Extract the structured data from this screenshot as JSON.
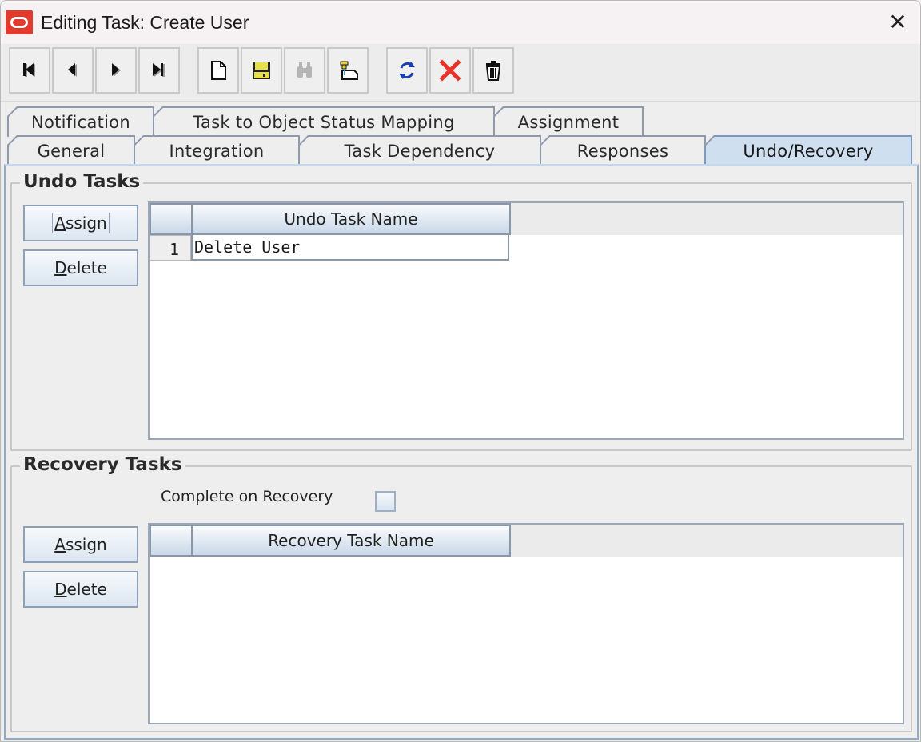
{
  "window": {
    "title": "Editing Task: Create User",
    "close_icon": "close-icon"
  },
  "toolbar": {
    "buttons": [
      {
        "name": "first-record",
        "icon": "skip-to-first-icon",
        "enabled": true
      },
      {
        "name": "previous-record",
        "icon": "previous-arrow-icon",
        "enabled": true
      },
      {
        "name": "next-record",
        "icon": "next-arrow-icon",
        "enabled": true
      },
      {
        "name": "last-record",
        "icon": "skip-to-last-icon",
        "enabled": true
      },
      {
        "name": "new",
        "icon": "new-document-icon",
        "enabled": true
      },
      {
        "name": "save",
        "icon": "floppy-disk-icon",
        "enabled": true
      },
      {
        "name": "find",
        "icon": "binoculars-icon",
        "enabled": false
      },
      {
        "name": "assign",
        "icon": "pushpin-note-icon",
        "enabled": true
      },
      {
        "name": "refresh",
        "icon": "refresh-arrows-icon",
        "enabled": true
      },
      {
        "name": "cancel",
        "icon": "red-x-icon",
        "enabled": true
      },
      {
        "name": "delete",
        "icon": "trash-can-icon",
        "enabled": true
      }
    ]
  },
  "tabs": {
    "row_back": [
      "Notification",
      "Task to Object Status Mapping",
      "Assignment"
    ],
    "row_front": [
      "General",
      "Integration",
      "Task Dependency",
      "Responses",
      "Undo/Recovery"
    ],
    "active": "Undo/Recovery"
  },
  "undo_tasks": {
    "title": "Undo Tasks",
    "assign_label": "Assign",
    "assign_mnemonic": "A",
    "assign_rest": "ssign",
    "delete_label": "Delete",
    "delete_mnemonic": "D",
    "delete_rest": "elete",
    "table": {
      "columns": [
        "",
        "Undo Task Name"
      ],
      "rows": [
        {
          "num": "1",
          "name": "Delete User"
        }
      ]
    }
  },
  "recovery_tasks": {
    "title": "Recovery Tasks",
    "complete_on_recovery_label": "Complete on Recovery",
    "complete_on_recovery_checked": false,
    "assign_label": "Assign",
    "assign_mnemonic": "A",
    "assign_rest": "ssign",
    "delete_label": "Delete",
    "delete_mnemonic": "D",
    "delete_rest": "elete",
    "table": {
      "columns": [
        "",
        "Recovery Task Name"
      ],
      "rows": []
    }
  },
  "colors": {
    "brand_red": "#e23a2c",
    "active_tab": "#cfdff0",
    "delete_red": "#e8322a",
    "refresh_blue": "#1a3fb0"
  }
}
